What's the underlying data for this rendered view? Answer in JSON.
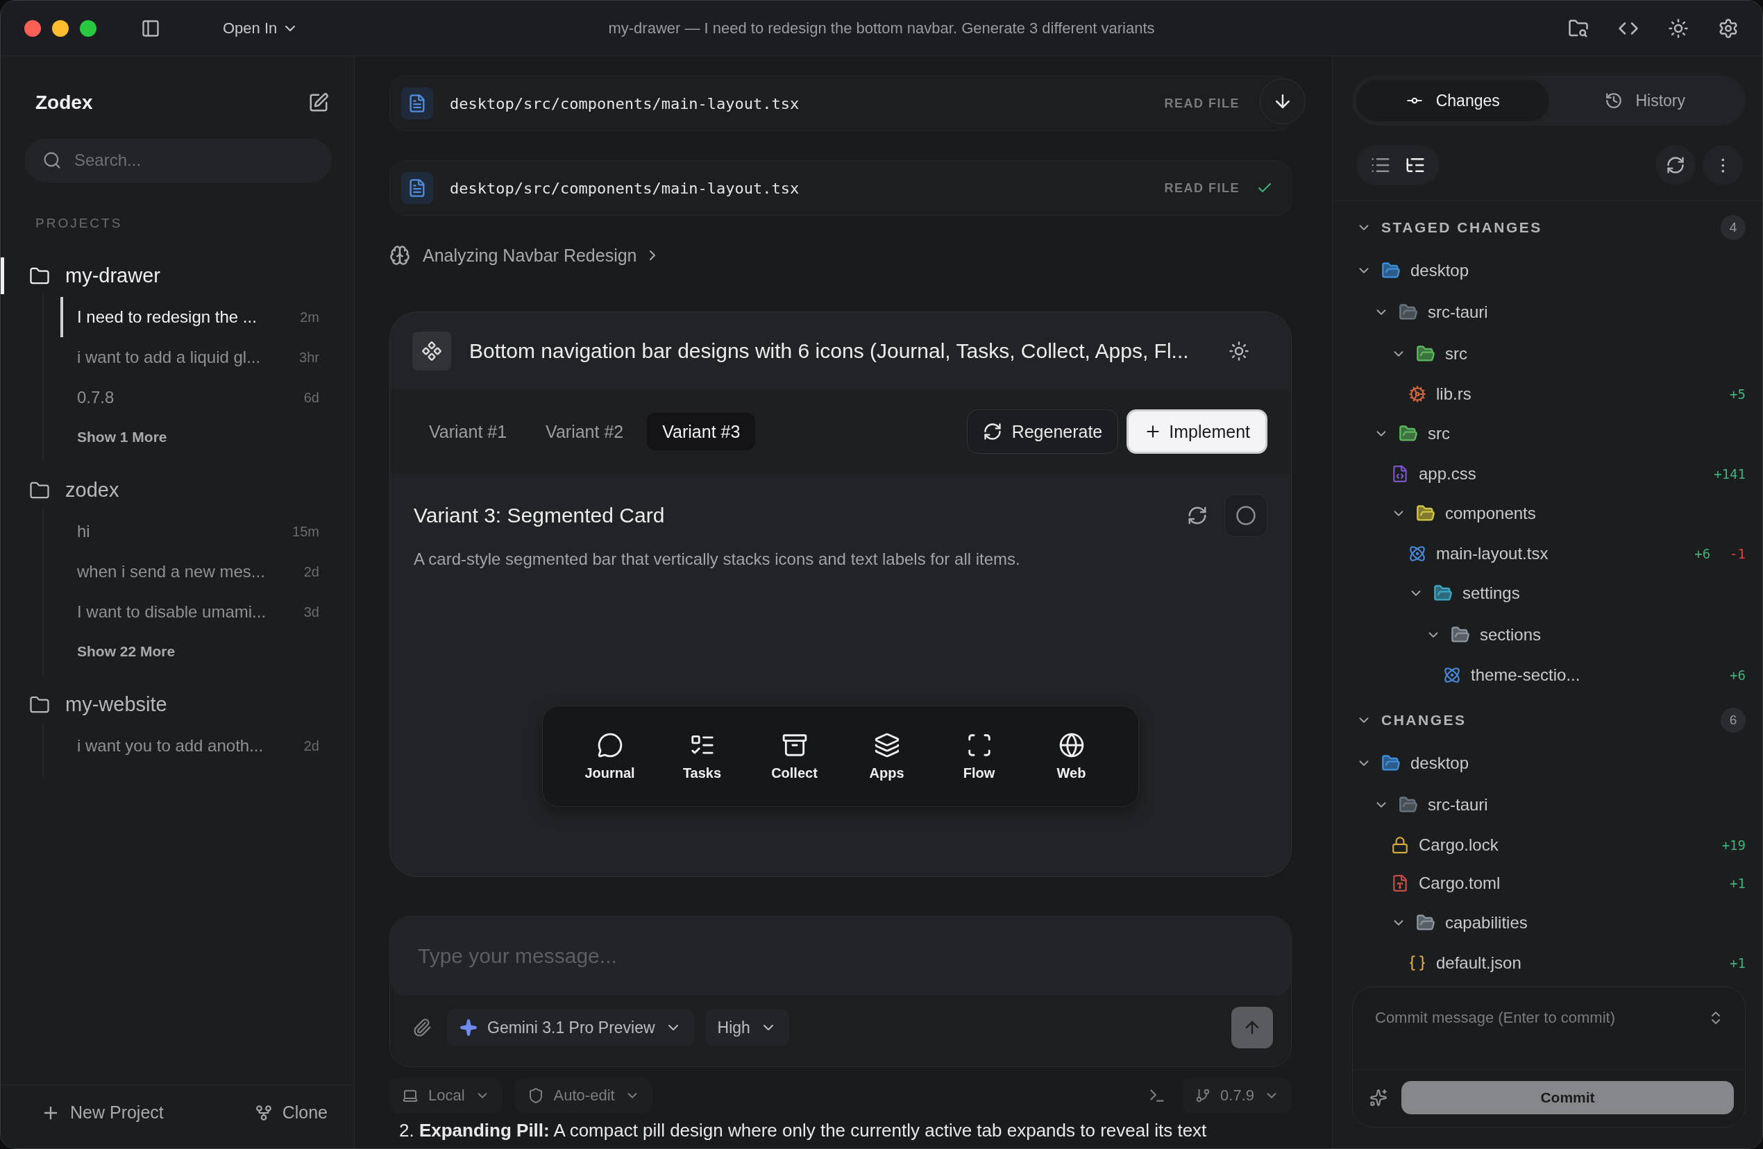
{
  "window": {
    "title": "my-drawer — I need to redesign the bottom navbar. Generate 3 different variants",
    "open_in": "Open In"
  },
  "sidebar": {
    "brand": "Zodex",
    "search": {
      "placeholder": "Search..."
    },
    "section": "PROJECTS",
    "projects": [
      {
        "name": "my-drawer",
        "selected": true,
        "chats": [
          {
            "title": "I need to redesign the ...",
            "age": "2m",
            "selected": true
          },
          {
            "title": "i want to add a liquid gl...",
            "age": "3hr",
            "selected": false
          },
          {
            "title": "0.7.8",
            "age": "6d",
            "selected": false
          }
        ],
        "more": "Show 1 More"
      },
      {
        "name": "zodex",
        "selected": false,
        "chats": [
          {
            "title": "hi",
            "age": "15m",
            "selected": false
          },
          {
            "title": "when i send a new mes...",
            "age": "2d",
            "selected": false
          },
          {
            "title": "I want to disable umami...",
            "age": "3d",
            "selected": false
          }
        ],
        "more": "Show 22 More"
      },
      {
        "name": "my-website",
        "selected": false,
        "chats": [
          {
            "title": "i want you to add anoth...",
            "age": "2d",
            "selected": false
          }
        ]
      }
    ],
    "footer": {
      "new_project": "New Project",
      "clone": "Clone"
    }
  },
  "main": {
    "tool_calls": [
      {
        "path": "desktop/src/components/main-layout.tsx",
        "status": "READ FILE",
        "done": false
      },
      {
        "path": "desktop/src/components/main-layout.tsx",
        "status": "READ FILE",
        "done": true
      }
    ],
    "thinking": "Analyzing Navbar Redesign",
    "artifact": {
      "title": "Bottom navigation bar designs with 6 icons (Journal, Tasks, Collect, Apps, Fl...",
      "tabs": [
        {
          "label": "Variant #1",
          "selected": false
        },
        {
          "label": "Variant #2",
          "selected": false
        },
        {
          "label": "Variant #3",
          "selected": true
        }
      ],
      "regenerate": "Regenerate",
      "implement": "Implement",
      "variant_title": "Variant 3: Segmented Card",
      "description": "A card-style segmented bar that vertically stacks icons and text labels for all items.",
      "nav_items": [
        {
          "label": "Journal"
        },
        {
          "label": "Tasks"
        },
        {
          "label": "Collect"
        },
        {
          "label": "Apps"
        },
        {
          "label": "Flow"
        },
        {
          "label": "Web"
        }
      ]
    },
    "composer": {
      "placeholder": "Type your message...",
      "model": "Gemini 3.1 Pro Preview",
      "effort": "High"
    },
    "status": {
      "location": "Local",
      "mode": "Auto-edit",
      "branch": "0.7.9"
    },
    "transcript": "2.  **Expanding Pill:** A compact pill design where only the currently active tab expands to reveal its text"
  },
  "git": {
    "tabs": [
      {
        "label": "Changes",
        "selected": true
      },
      {
        "label": "History",
        "selected": false
      }
    ],
    "views": [
      {
        "selected": false
      },
      {
        "selected": true
      }
    ],
    "sections": [
      {
        "title": "STAGED CHANGES",
        "count": "4",
        "expanded": true,
        "tree": [
          {
            "name": "desktop",
            "kind": "desktop",
            "expanded": true,
            "children": [
              {
                "name": "src-tauri",
                "kind": "tauri",
                "expanded": true,
                "children": [
                  {
                    "name": "src",
                    "kind": "source",
                    "expanded": true,
                    "children": [
                      {
                        "name": "lib.rs",
                        "kind": "rust",
                        "added": "+5"
                      }
                    ]
                  }
                ]
              },
              {
                "name": "src",
                "kind": "source",
                "expanded": true,
                "children": [
                  {
                    "name": "app.css",
                    "kind": "css",
                    "added": "+141"
                  },
                  {
                    "name": "components",
                    "kind": "components",
                    "expanded": true,
                    "children": [
                      {
                        "name": "main-layout.tsx",
                        "kind": "react",
                        "added": "+6",
                        "removed": "-1"
                      },
                      {
                        "name": "settings",
                        "kind": "settings",
                        "expanded": true,
                        "children": [
                          {
                            "name": "sections",
                            "kind": "folder",
                            "expanded": true,
                            "children": [
                              {
                                "name": "theme-sectio...",
                                "kind": "react",
                                "added": "+6"
                              }
                            ]
                          }
                        ]
                      }
                    ]
                  }
                ]
              }
            ]
          }
        ]
      },
      {
        "title": "CHANGES",
        "count": "6",
        "expanded": true,
        "tree": [
          {
            "name": "desktop",
            "kind": "desktop",
            "expanded": true,
            "children": [
              {
                "name": "src-tauri",
                "kind": "tauri",
                "expanded": true,
                "children": [
                  {
                    "name": "Cargo.lock",
                    "kind": "lock",
                    "added": "+19"
                  },
                  {
                    "name": "Cargo.toml",
                    "kind": "toml",
                    "added": "+1"
                  },
                  {
                    "name": "capabilities",
                    "kind": "folder",
                    "expanded": true,
                    "children": [
                      {
                        "name": "default.json",
                        "kind": "json",
                        "added": "+1"
                      }
                    ]
                  }
                ]
              }
            ]
          }
        ]
      }
    ],
    "commit": {
      "placeholder": "Commit message (Enter to commit)",
      "button": "Commit"
    }
  }
}
